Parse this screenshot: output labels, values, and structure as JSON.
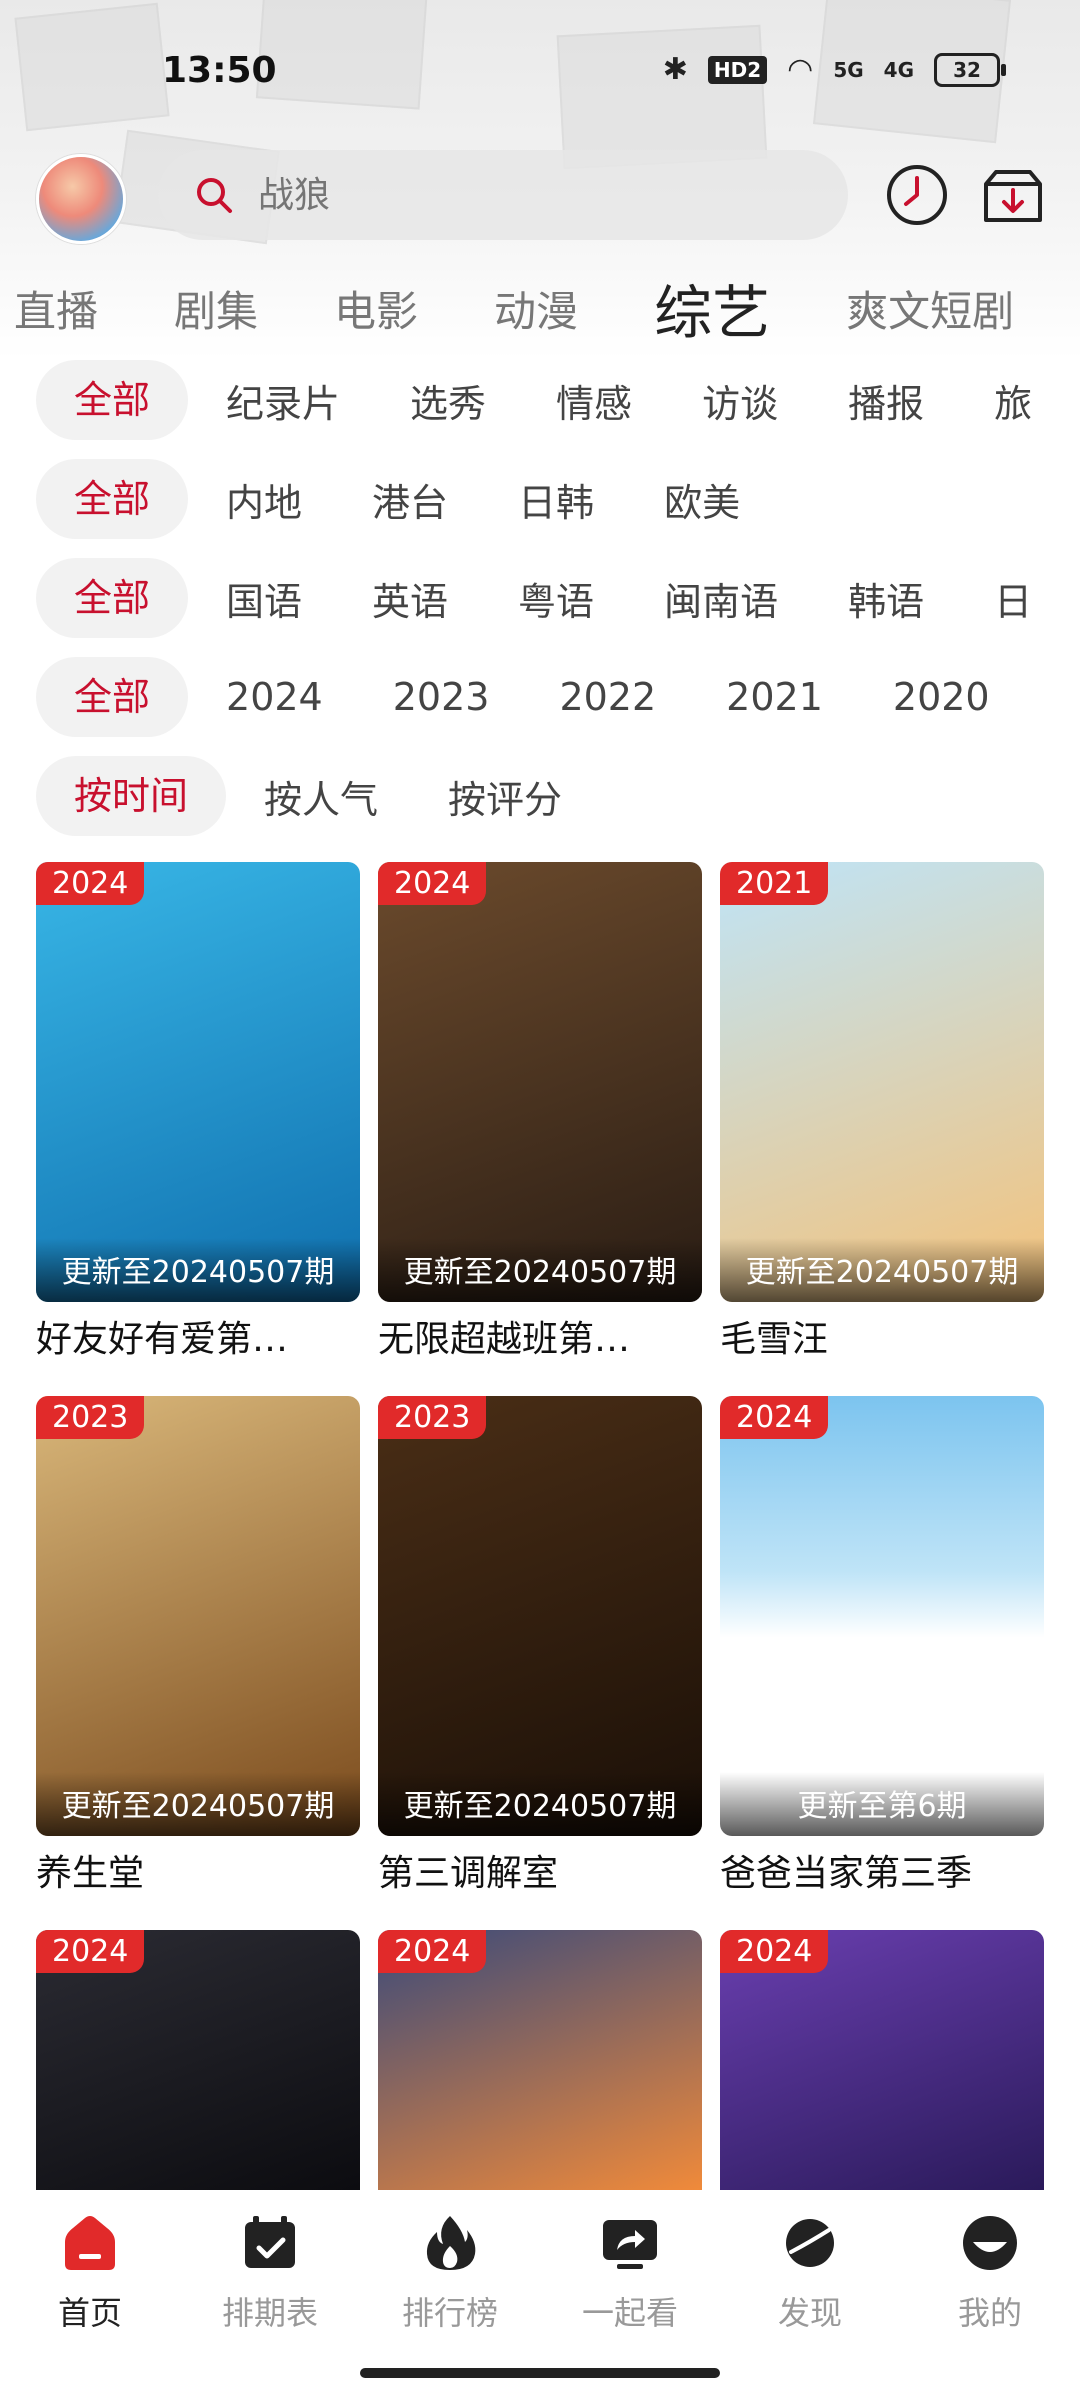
{
  "status_bar": {
    "time": "13:50",
    "network_hd": "HD2",
    "sig1": "5G",
    "sig2": "4G",
    "battery": "32"
  },
  "header": {
    "search_placeholder": "战狼"
  },
  "category_tabs": [
    {
      "label": "直播",
      "active": false
    },
    {
      "label": "剧集",
      "active": false
    },
    {
      "label": "电影",
      "active": false
    },
    {
      "label": "动漫",
      "active": false
    },
    {
      "label": "综艺",
      "active": true
    },
    {
      "label": "爽文短剧",
      "active": false
    }
  ],
  "filters": {
    "type": [
      "全部",
      "纪录片",
      "选秀",
      "情感",
      "访谈",
      "播报",
      "旅"
    ],
    "region": [
      "全部",
      "内地",
      "港台",
      "日韩",
      "欧美"
    ],
    "language": [
      "全部",
      "国语",
      "英语",
      "粤语",
      "闽南语",
      "韩语",
      "日"
    ],
    "year": [
      "全部",
      "2024",
      "2023",
      "2022",
      "2021",
      "2020"
    ],
    "sort": [
      "按时间",
      "按人气",
      "按评分"
    ]
  },
  "cards": [
    {
      "year": "2024",
      "update": "更新至20240507期",
      "title": "好友好有爱第…",
      "color1": "#38b6e6",
      "color2": "#0f6fae"
    },
    {
      "year": "2024",
      "update": "更新至20240507期",
      "title": "无限超越班第…",
      "color1": "#6b4a2c",
      "color2": "#2a1d14"
    },
    {
      "year": "2021",
      "update": "更新至20240507期",
      "title": "毛雪汪",
      "color1": "#bfe4f7",
      "color2": "#f4c27a"
    },
    {
      "year": "2023",
      "update": "更新至20240507期",
      "title": "养生堂",
      "color1": "#d9b77a",
      "color2": "#7a4a1c"
    },
    {
      "year": "2023",
      "update": "更新至20240507期",
      "title": "第三调解室",
      "color1": "#4a2e16",
      "color2": "#1a0f07"
    },
    {
      "year": "2024",
      "update": "更新至第6期",
      "title": "爸爸当家第三季",
      "color1": "#7cc4ef",
      "color2": "#ffffff"
    },
    {
      "year": "2024",
      "update": "",
      "title": "",
      "color1": "#2b2b33",
      "color2": "#0c0c10"
    },
    {
      "year": "2024",
      "update": "",
      "title": "",
      "color1": "#3b4a7a",
      "color2": "#f08a3a"
    },
    {
      "year": "2024",
      "update": "",
      "title": "",
      "color1": "#6a3fb0",
      "color2": "#2a1a5a"
    }
  ],
  "nav": [
    {
      "label": "首页",
      "icon": "home-icon",
      "active": true
    },
    {
      "label": "排期表",
      "icon": "calendar-icon",
      "active": false
    },
    {
      "label": "排行榜",
      "icon": "flame-icon",
      "active": false
    },
    {
      "label": "一起看",
      "icon": "share-screen-icon",
      "active": false
    },
    {
      "label": "发现",
      "icon": "planet-icon",
      "active": false
    },
    {
      "label": "我的",
      "icon": "profile-icon",
      "active": false
    }
  ],
  "colors": {
    "accent": "#c8102e",
    "badge": "#e12a2a"
  }
}
